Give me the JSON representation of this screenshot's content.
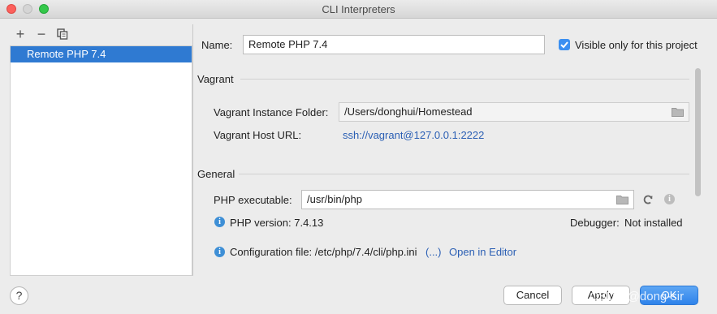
{
  "window": {
    "title": "CLI Interpreters"
  },
  "toolbar": {
    "add": "+",
    "remove": "−"
  },
  "interpreters": {
    "items": [
      "Remote PHP 7.4"
    ]
  },
  "name_field": {
    "label": "Name:",
    "value": "Remote PHP 7.4"
  },
  "visible_only": {
    "label": "Visible only for this project",
    "checked": true
  },
  "vagrant": {
    "section_title": "Vagrant",
    "folder_label": "Vagrant Instance Folder:",
    "folder_value": "/Users/donghui/Homestead",
    "host_label": "Vagrant Host URL:",
    "host_value": "ssh://vagrant@127.0.0.1:2222"
  },
  "general": {
    "section_title": "General",
    "php_exec_label": "PHP executable:",
    "php_exec_value": "/usr/bin/php",
    "php_version": "PHP version: 7.4.13",
    "debugger_label": "Debugger:",
    "debugger_value": "Not installed",
    "config_file": "Configuration file: /etc/php/7.4/cli/php.ini",
    "config_more": "(...)",
    "open_in_editor": "Open in Editor"
  },
  "buttons": {
    "help": "?",
    "cancel": "Cancel",
    "apply": "Apply",
    "ok": "OK"
  },
  "watermark": "CSDN @dong-sir",
  "colors": {
    "selection": "#2f7ad2",
    "link": "#2b5fb4",
    "primary": "#3b8ff1"
  }
}
